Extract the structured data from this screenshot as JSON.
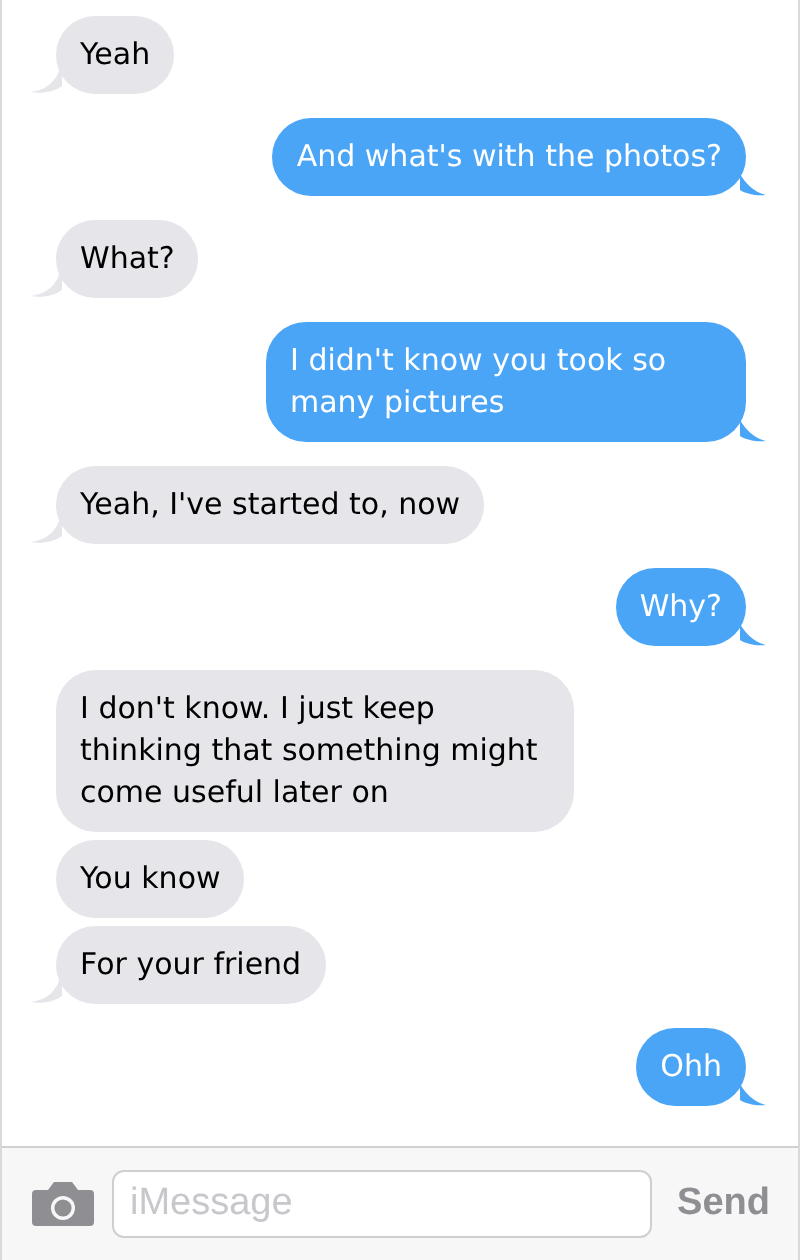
{
  "messages": [
    {
      "outgoing": false,
      "text": "Yeah",
      "tail": true
    },
    {
      "outgoing": true,
      "text": "And what's with the photos?",
      "tail": true
    },
    {
      "outgoing": false,
      "text": "What?",
      "tail": true
    },
    {
      "outgoing": true,
      "text": "I didn't know you took so many pictures",
      "tail": true
    },
    {
      "outgoing": false,
      "text": "Yeah, I've started to, now",
      "tail": true
    },
    {
      "outgoing": true,
      "text": "Why?",
      "tail": true
    },
    {
      "outgoing": false,
      "text": "I don't know. I just keep thinking that something might come useful later on",
      "tail": false
    },
    {
      "outgoing": false,
      "text": "You know",
      "tail": false
    },
    {
      "outgoing": false,
      "text": "For your friend",
      "tail": true
    },
    {
      "outgoing": true,
      "text": "Ohh",
      "tail": true
    }
  ],
  "composer": {
    "placeholder": "iMessage",
    "send_label": "Send"
  }
}
